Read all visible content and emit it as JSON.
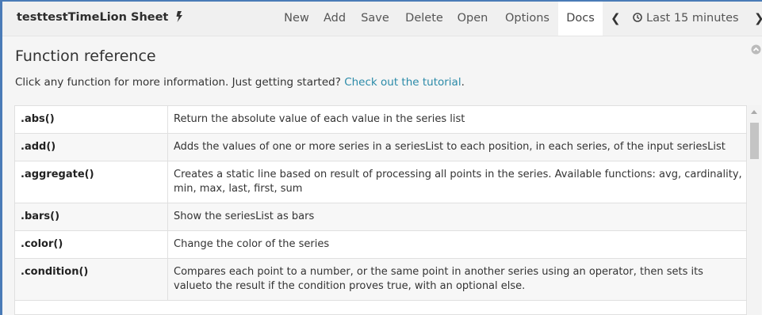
{
  "sheet": {
    "title": "testtestTimeLion Sheet"
  },
  "toolbar": {
    "items": [
      {
        "label": "New"
      },
      {
        "label": "Add"
      },
      {
        "label": "Save"
      },
      {
        "label": "Delete"
      },
      {
        "label": "Open"
      },
      {
        "label": "Options"
      },
      {
        "label": "Docs",
        "active": true
      }
    ],
    "time_range": "Last 15 minutes"
  },
  "docs": {
    "heading": "Function reference",
    "intro_text": "Click any function for more information. Just getting started? ",
    "tutorial_link": "Check out the tutorial",
    "intro_end": ".",
    "functions": [
      {
        "name": ".abs()",
        "description": "Return the absolute value of each value in the series list"
      },
      {
        "name": ".add()",
        "description": "Adds the values of one or more series in a seriesList to each position, in each series, of the input seriesList"
      },
      {
        "name": ".aggregate()",
        "description": "Creates a static line based on result of processing all points in the series. Available functions: avg, cardinality, min, max, last, first, sum"
      },
      {
        "name": ".bars()",
        "description": "Show the seriesList as bars"
      },
      {
        "name": ".color()",
        "description": "Change the color of the series"
      },
      {
        "name": ".condition()",
        "description": "Compares each point to a number, or the same point in another series using an operator, then sets its valueto the result if the condition proves true, with an optional else."
      }
    ]
  },
  "colors": {
    "link": "#2a8aa8",
    "frame": "#4a7bb7",
    "active_tab_bg": "#ffffff"
  }
}
